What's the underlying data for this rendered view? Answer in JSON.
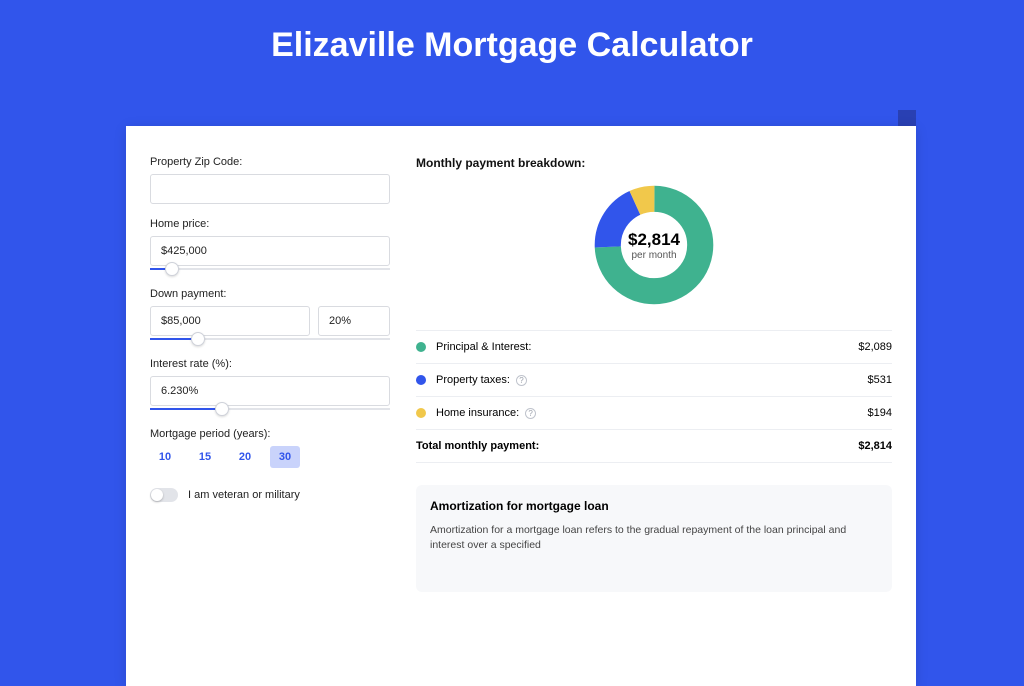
{
  "title": "Elizaville Mortgage Calculator",
  "form": {
    "zip_label": "Property Zip Code:",
    "zip_value": "",
    "home_price_label": "Home price:",
    "home_price_value": "$425,000",
    "home_price_slider_pct": 9,
    "down_label": "Down payment:",
    "down_value": "$85,000",
    "down_pct": "20%",
    "down_slider_pct": 20,
    "rate_label": "Interest rate (%):",
    "rate_value": "6.230%",
    "rate_slider_pct": 30,
    "period_label": "Mortgage period (years):",
    "periods": [
      "10",
      "15",
      "20",
      "30"
    ],
    "period_active": "30",
    "veteran_label": "I am veteran or military"
  },
  "breakdown": {
    "title": "Monthly payment breakdown:",
    "total_value": "$2,814",
    "total_sub": "per month",
    "items": [
      {
        "label": "Principal & Interest:",
        "value": "$2,089",
        "color": "#3fb28f",
        "info": false
      },
      {
        "label": "Property taxes:",
        "value": "$531",
        "color": "#3155eb",
        "info": true
      },
      {
        "label": "Home insurance:",
        "value": "$194",
        "color": "#f1c84b",
        "info": true
      }
    ],
    "total_row": {
      "label": "Total monthly payment:",
      "value": "$2,814"
    }
  },
  "chart_data": {
    "type": "pie",
    "title": "Monthly payment breakdown",
    "hole": 0.7,
    "center_label": "$2,814 per month",
    "series": [
      {
        "name": "Principal & Interest",
        "value": 2089,
        "color": "#3fb28f"
      },
      {
        "name": "Property taxes",
        "value": 531,
        "color": "#3155eb"
      },
      {
        "name": "Home insurance",
        "value": 194,
        "color": "#f1c84b"
      }
    ],
    "total": 2814
  },
  "amort": {
    "title": "Amortization for mortgage loan",
    "body": "Amortization for a mortgage loan refers to the gradual repayment of the loan principal and interest over a specified"
  }
}
